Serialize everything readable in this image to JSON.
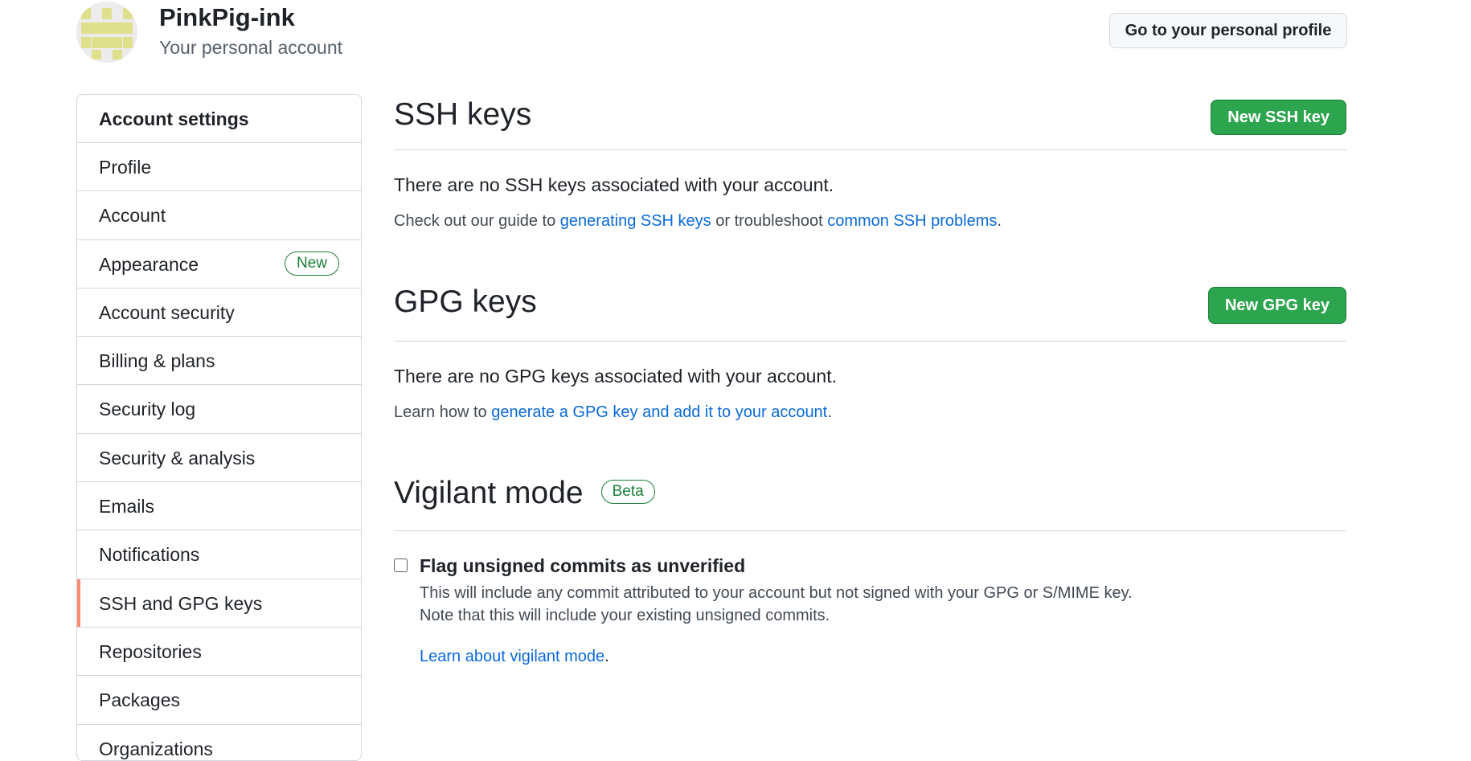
{
  "header": {
    "user_name": "PinkPig-ink",
    "user_subtitle": "Your personal account",
    "profile_button": "Go to your personal profile"
  },
  "sidebar": {
    "heading": "Account settings",
    "items": [
      {
        "label": "Profile"
      },
      {
        "label": "Account"
      },
      {
        "label": "Appearance",
        "badge": "New"
      },
      {
        "label": "Account security"
      },
      {
        "label": "Billing & plans"
      },
      {
        "label": "Security log"
      },
      {
        "label": "Security & analysis"
      },
      {
        "label": "Emails"
      },
      {
        "label": "Notifications"
      },
      {
        "label": "SSH and GPG keys",
        "selected": true
      },
      {
        "label": "Repositories"
      },
      {
        "label": "Packages"
      },
      {
        "label": "Organizations"
      }
    ]
  },
  "ssh": {
    "title": "SSH keys",
    "button": "New SSH key",
    "empty_text": "There are no SSH keys associated with your account.",
    "guide_prefix": "Check out our guide to ",
    "guide_link1": "generating SSH keys",
    "guide_middle": " or troubleshoot ",
    "guide_link2": "common SSH problems",
    "guide_suffix": "."
  },
  "gpg": {
    "title": "GPG keys",
    "button": "New GPG key",
    "empty_text": "There are no GPG keys associated with your account.",
    "learn_prefix": "Learn how to ",
    "learn_link": "generate a GPG key and add it to your account",
    "learn_suffix": "."
  },
  "vigilant": {
    "title": "Vigilant mode",
    "badge": "Beta",
    "checkbox_label": "Flag unsigned commits as unverified",
    "checkbox_checked": false,
    "desc_line1": "This will include any commit attributed to your account but not signed with your GPG or S/MIME key.",
    "desc_line2": "Note that this will include your existing unsigned commits.",
    "learn_link": "Learn about vigilant mode",
    "learn_suffix": "."
  },
  "colors": {
    "primary_button": "#2da44e",
    "link": "#0969da",
    "selected_indicator": "#fd8c73",
    "badge_green": "#1a7f37"
  }
}
